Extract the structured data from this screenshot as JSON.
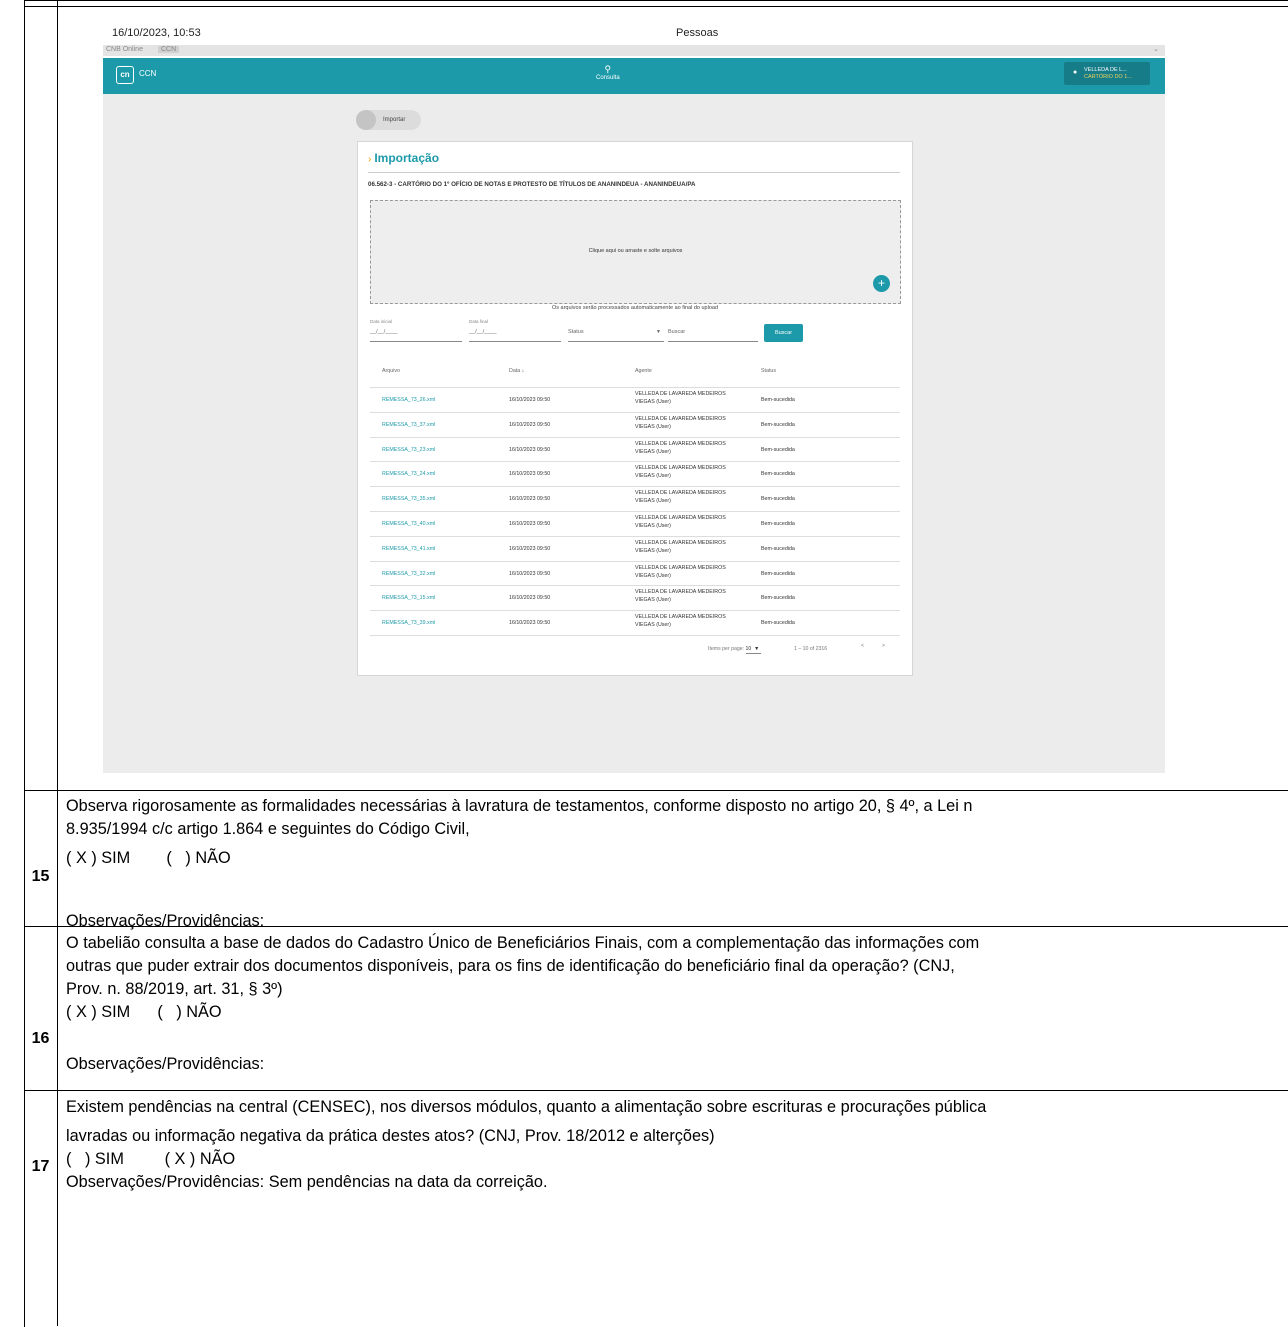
{
  "screenshot": {
    "datetime": "16/10/2023, 10:53",
    "page_title": "Pessoas",
    "browser_tab": "CNB Online",
    "browser_tab_sub": "CCN",
    "app_logo": "cn",
    "app_name": "CCN",
    "nav_consulta": "Consulta",
    "user_name": "VELLEDA DE L...",
    "user_office": "CARTÓRIO DO 1...",
    "import_chip": "Importar",
    "card_title": "Importação",
    "cartorio": "06.562-3 - CARTÓRIO DO 1º OFÍCIO DE NOTAS E PROTESTO DE TÍTULOS DE ANANINDEUA - ANANINDEUA/PA",
    "dropzone_msg": "Clique aqui ou arraste e solte arquivos",
    "auto_msg": "Os arquivos serão processados automaticamente ao final do upload",
    "filters": {
      "data_inicial_label": "Data inicial",
      "data_inicial_value": "__/__/____",
      "data_final_label": "Data final",
      "data_final_value": "__/__/____",
      "status_placeholder": "Status",
      "buscar_placeholder": "Buscar",
      "buscar_button": "Buscar"
    },
    "table": {
      "headers": [
        "Arquivo",
        "Data ↓",
        "Agente",
        "Status"
      ],
      "rows": [
        {
          "arquivo": "REMESSA_73_26.xml",
          "data": "16/10/2023 09:50",
          "agente1": "VELLEDA DE LAVAREDA MEDEIROS",
          "agente2": "VIEGAS (User)",
          "status": "Bem-sucedida"
        },
        {
          "arquivo": "REMESSA_73_37.xml",
          "data": "16/10/2023 09:50",
          "agente1": "VELLEDA DE LAVAREDA MEDEIROS",
          "agente2": "VIEGAS (User)",
          "status": "Bem-sucedida"
        },
        {
          "arquivo": "REMESSA_73_23.xml",
          "data": "16/10/2023 09:50",
          "agente1": "VELLEDA DE LAVAREDA MEDEIROS",
          "agente2": "VIEGAS (User)",
          "status": "Bem-sucedida"
        },
        {
          "arquivo": "REMESSA_73_24.xml",
          "data": "16/10/2023 09:50",
          "agente1": "VELLEDA DE LAVAREDA MEDEIROS",
          "agente2": "VIEGAS (User)",
          "status": "Bem-sucedida"
        },
        {
          "arquivo": "REMESSA_73_35.xml",
          "data": "16/10/2023 09:50",
          "agente1": "VELLEDA DE LAVAREDA MEDEIROS",
          "agente2": "VIEGAS (User)",
          "status": "Bem-sucedida"
        },
        {
          "arquivo": "REMESSA_73_40.xml",
          "data": "16/10/2023 09:50",
          "agente1": "VELLEDA DE LAVAREDA MEDEIROS",
          "agente2": "VIEGAS (User)",
          "status": "Bem-sucedida"
        },
        {
          "arquivo": "REMESSA_73_41.xml",
          "data": "16/10/2023 09:50",
          "agente1": "VELLEDA DE LAVAREDA MEDEIROS",
          "agente2": "VIEGAS (User)",
          "status": "Bem-sucedida"
        },
        {
          "arquivo": "REMESSA_73_32.xml",
          "data": "16/10/2023 09:50",
          "agente1": "VELLEDA DE LAVAREDA MEDEIROS",
          "agente2": "VIEGAS (User)",
          "status": "Bem-sucedida"
        },
        {
          "arquivo": "REMESSA_73_15.xml",
          "data": "16/10/2023 09:50",
          "agente1": "VELLEDA DE LAVAREDA MEDEIROS",
          "agente2": "VIEGAS (User)",
          "status": "Bem-sucedida"
        },
        {
          "arquivo": "REMESSA_73_39.xml",
          "data": "16/10/2023 09:50",
          "agente1": "VELLEDA DE LAVAREDA MEDEIROS",
          "agente2": "VIEGAS (User)",
          "status": "Bem-sucedida"
        }
      ]
    },
    "pager": {
      "items_label": "Items per page:",
      "items_value": "10",
      "range": "1 – 10 of 2316",
      "prev": "<",
      "next": ">"
    }
  },
  "questions": [
    {
      "number": "15",
      "lines": [
        "Observa rigorosamente as formalidades necessárias à lavratura de testamentos, conforme disposto no artigo 20, § 4º, a Lei n",
        "8.935/1994 c/c artigo 1.864 e seguintes do Código Civil,",
        "( X ) SIM        (   ) NÃO",
        "",
        "Observações/Providências:"
      ]
    },
    {
      "number": "16",
      "lines": [
        "O tabelião consulta a base de dados do Cadastro Único de Beneficiários Finais, com a complementação das informações com",
        "outras que puder extrair dos documentos disponíveis, para os fins de identificação do beneficiário final da operação? (CNJ,",
        "Prov. n. 88/2019, art. 31, § 3º)",
        "( X ) SIM      (   ) NÃO",
        "",
        "Observações/Providências:"
      ]
    },
    {
      "number": "17",
      "lines": [
        "Existem pendências na central (CENSEC), nos diversos módulos, quanto a alimentação sobre escrituras e procurações pública",
        "lavradas ou informação negativa da prática destes atos? (CNJ, Prov. 18/2012 e alterções)",
        "(   ) SIM         ( X ) NÃO",
        "Observações/Providências: Sem pendências na data da correição."
      ]
    }
  ]
}
